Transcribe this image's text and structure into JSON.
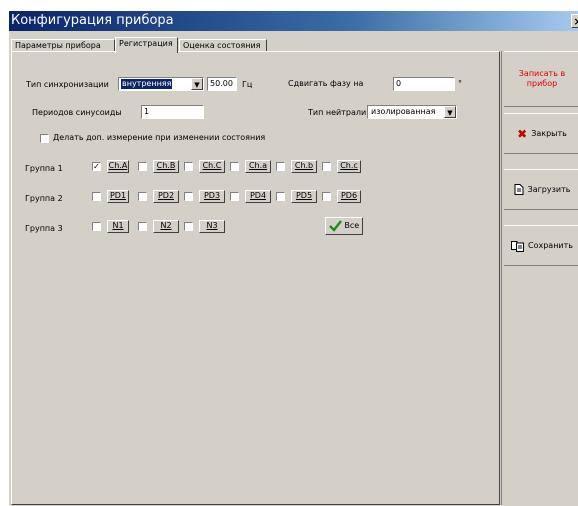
{
  "window": {
    "title": "Конфигурация прибора",
    "close_glyph": "×"
  },
  "tabs": [
    "Параметры прибора",
    "Регистрация",
    "Оценка состояния"
  ],
  "form": {
    "sync_label": "Тип синхронизации",
    "sync_value": "внутренняя",
    "freq_value": "50.00",
    "freq_unit": "Гц",
    "phase_label": "Сдвигать фазу на",
    "phase_value": "0",
    "phase_unit": "°",
    "periods_label": "Периодов синусоиды",
    "periods_value": "1",
    "neutral_label": "Тип нейтрали",
    "neutral_value": "изолированная",
    "extra_measure_label": "Делать доп. измерение при изменении состояния"
  },
  "groups": [
    {
      "label": "Группа 1",
      "channels": [
        {
          "name": "Ch.A",
          "checked": true
        },
        {
          "name": "Ch.B",
          "checked": false
        },
        {
          "name": "Ch.C",
          "checked": false
        },
        {
          "name": "Ch.a",
          "checked": false
        },
        {
          "name": "Ch.b",
          "checked": false
        },
        {
          "name": "Ch.c",
          "checked": false
        }
      ]
    },
    {
      "label": "Группа 2",
      "channels": [
        {
          "name": "PD1",
          "checked": false
        },
        {
          "name": "PD2",
          "checked": false
        },
        {
          "name": "PD3",
          "checked": false
        },
        {
          "name": "PD4",
          "checked": false
        },
        {
          "name": "PD5",
          "checked": false
        },
        {
          "name": "PD6",
          "checked": false
        }
      ]
    },
    {
      "label": "Группа 3",
      "channels": [
        {
          "name": "N1",
          "checked": false
        },
        {
          "name": "N2",
          "checked": false
        },
        {
          "name": "N3",
          "checked": false
        }
      ]
    }
  ],
  "all_button": {
    "label": "Все",
    "icon": "checkmark-icon"
  },
  "side": {
    "write_label": "Записать в прибор",
    "close_label": "Закрыть",
    "load_label": "Загрузить",
    "save_label": "Сохранить"
  },
  "colors": {
    "title_start": "#0a246a",
    "title_end": "#a6caf0",
    "face": "#d4d0c8",
    "write_text": "#e00000"
  }
}
